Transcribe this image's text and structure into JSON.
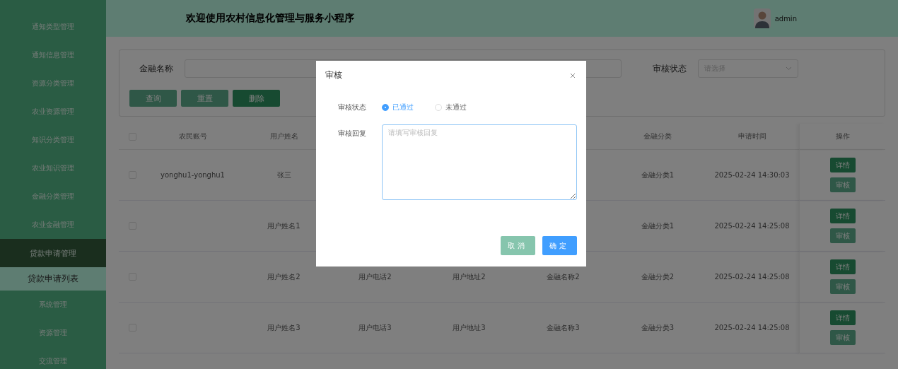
{
  "sidebar": {
    "items": [
      {
        "label": "通知类型管理",
        "selected": false,
        "expanded": false
      },
      {
        "label": "通知信息管理",
        "selected": false,
        "expanded": false
      },
      {
        "label": "资源分类管理",
        "selected": false,
        "expanded": false
      },
      {
        "label": "农业资源管理",
        "selected": false,
        "expanded": false
      },
      {
        "label": "知识分类管理",
        "selected": false,
        "expanded": false
      },
      {
        "label": "农业知识管理",
        "selected": false,
        "expanded": false
      },
      {
        "label": "金融分类管理",
        "selected": false,
        "expanded": false
      },
      {
        "label": "农业金融管理",
        "selected": false,
        "expanded": false
      },
      {
        "label": "贷款申请管理",
        "selected": false,
        "expanded": true,
        "children": [
          {
            "label": "贷款申请列表",
            "selected": true
          }
        ]
      },
      {
        "label": "系统管理",
        "selected": false,
        "expanded": false
      },
      {
        "label": "资源管理",
        "selected": false,
        "expanded": false
      },
      {
        "label": "交流管理",
        "selected": false,
        "expanded": false
      }
    ]
  },
  "header": {
    "title": "欢迎使用农村信息化管理与服务小程序",
    "user": "admin"
  },
  "search": {
    "fields": [
      {
        "label": "金融名称",
        "kind": "input"
      },
      {
        "label": "审核状态",
        "kind": "select",
        "placeholder": "请选择"
      }
    ],
    "buttons": [
      {
        "label": "查询",
        "kind": "plain"
      },
      {
        "label": "重置",
        "kind": "plain"
      },
      {
        "label": "删除",
        "kind": "danger"
      }
    ]
  },
  "table": {
    "header_checked": false,
    "columns": [
      "农民账号",
      "用户姓名",
      null,
      null,
      null,
      "金融分类",
      "申请时间"
    ],
    "action_column": "操作",
    "rows": [
      {
        "checked": false,
        "cells": [
          "yonghu1-yonghu1",
          "张三",
          null,
          null,
          null,
          "金融分类1",
          "2025-02-24 14:30:03"
        ],
        "actions": [
          "详情",
          "审核"
        ]
      },
      {
        "checked": false,
        "cells": [
          null,
          "用户姓名1",
          null,
          null,
          null,
          "金融分类1",
          "2025-02-24 14:25:08"
        ],
        "actions": [
          "详情",
          "审核"
        ]
      },
      {
        "checked": false,
        "cells": [
          null,
          "用户姓名2",
          "用户电话2",
          "用户地址2",
          "金融名称2",
          "金融分类2",
          "2025-02-24 14:25:08"
        ],
        "actions": [
          "详情",
          "审核"
        ]
      },
      {
        "checked": false,
        "cells": [
          null,
          "用户姓名3",
          "用户电话3",
          "用户地址3",
          "金融名称3",
          "金融分类3",
          "2025-02-24 14:25:08"
        ],
        "actions": [
          "详情",
          "审核"
        ]
      }
    ]
  },
  "modal": {
    "title": "审核",
    "status_label": "审核状态",
    "options": [
      {
        "label": "已通过",
        "selected": true
      },
      {
        "label": "未通过",
        "selected": false
      }
    ],
    "reply_label": "审核回复",
    "reply_placeholder": "请填写审核回复",
    "buttons": [
      {
        "label": "取消",
        "kind": "cancel"
      },
      {
        "label": "确定",
        "kind": "primary"
      }
    ]
  }
}
